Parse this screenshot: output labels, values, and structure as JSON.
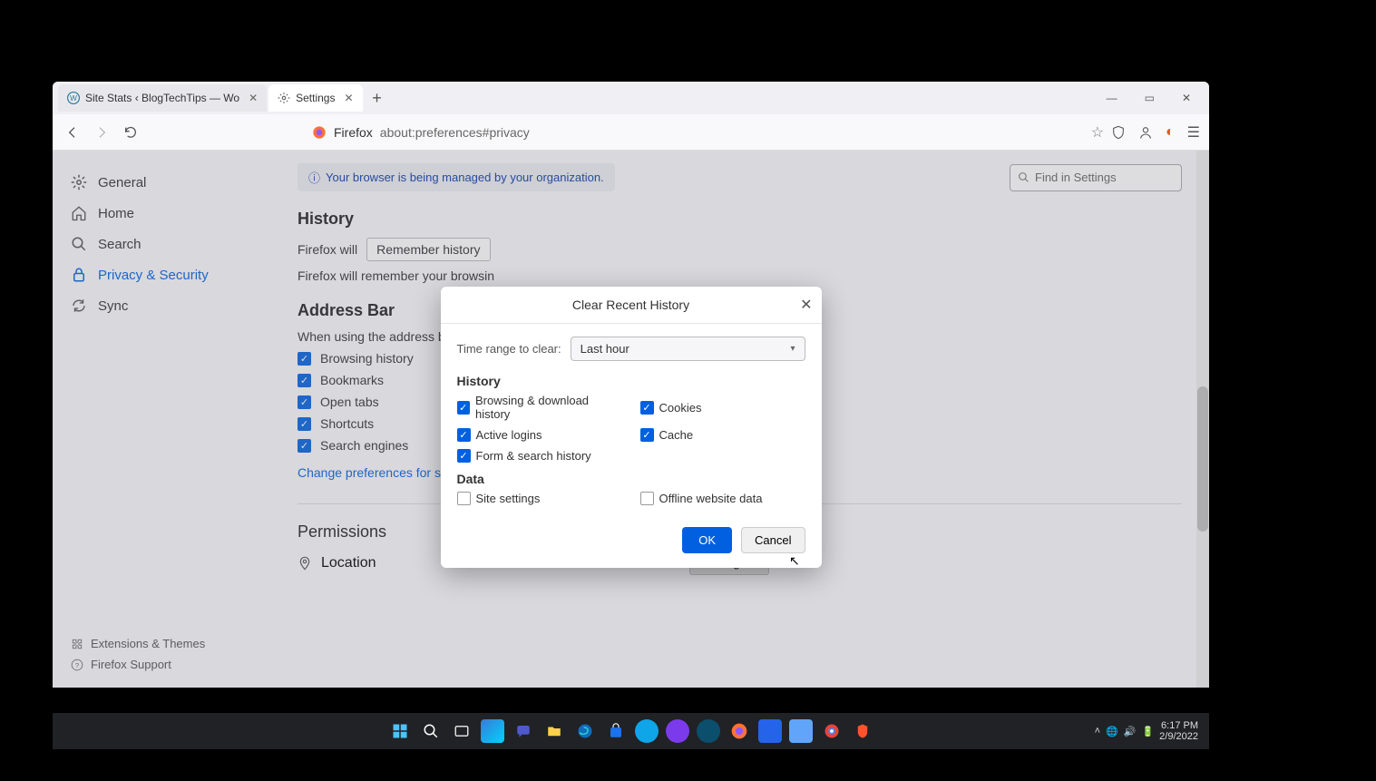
{
  "tabs": [
    {
      "label": "Site Stats ‹ BlogTechTips — Wo"
    },
    {
      "label": "Settings"
    }
  ],
  "url": {
    "brand": "Firefox",
    "path": "about:preferences#privacy"
  },
  "sidebar": {
    "items": [
      {
        "label": "General"
      },
      {
        "label": "Home"
      },
      {
        "label": "Search"
      },
      {
        "label": "Privacy & Security"
      },
      {
        "label": "Sync"
      }
    ],
    "footer": [
      {
        "label": "Extensions & Themes"
      },
      {
        "label": "Firefox Support"
      }
    ]
  },
  "banner": "Your browser is being managed by your organization.",
  "search_placeholder": "Find in Settings",
  "sections": {
    "history_title": "History",
    "firefox_will": "Firefox will",
    "remember": "Remember history",
    "remember_desc": "Firefox will remember your browsin",
    "addressbar_title": "Address Bar",
    "addressbar_desc": "When using the address bar, sugge",
    "addr_opts": [
      "Browsing history",
      "Bookmarks",
      "Open tabs",
      "Shortcuts",
      "Search engines"
    ],
    "change_prefs": "Change preferences for search engine suggestions",
    "permissions_title": "Permissions",
    "location_label": "Location",
    "settings_btn": "Settings..."
  },
  "dialog": {
    "title": "Clear Recent History",
    "time_label": "Time range to clear:",
    "time_value": "Last hour",
    "history_section": "History",
    "data_section": "Data",
    "history_items_left": [
      "Browsing & download history",
      "Active logins",
      "Form & search history"
    ],
    "history_items_right": [
      "Cookies",
      "Cache"
    ],
    "data_items": [
      "Site settings",
      "Offline website data"
    ],
    "ok": "OK",
    "cancel": "Cancel"
  },
  "taskbar": {
    "time": "6:17 PM",
    "date": "2/9/2022"
  }
}
